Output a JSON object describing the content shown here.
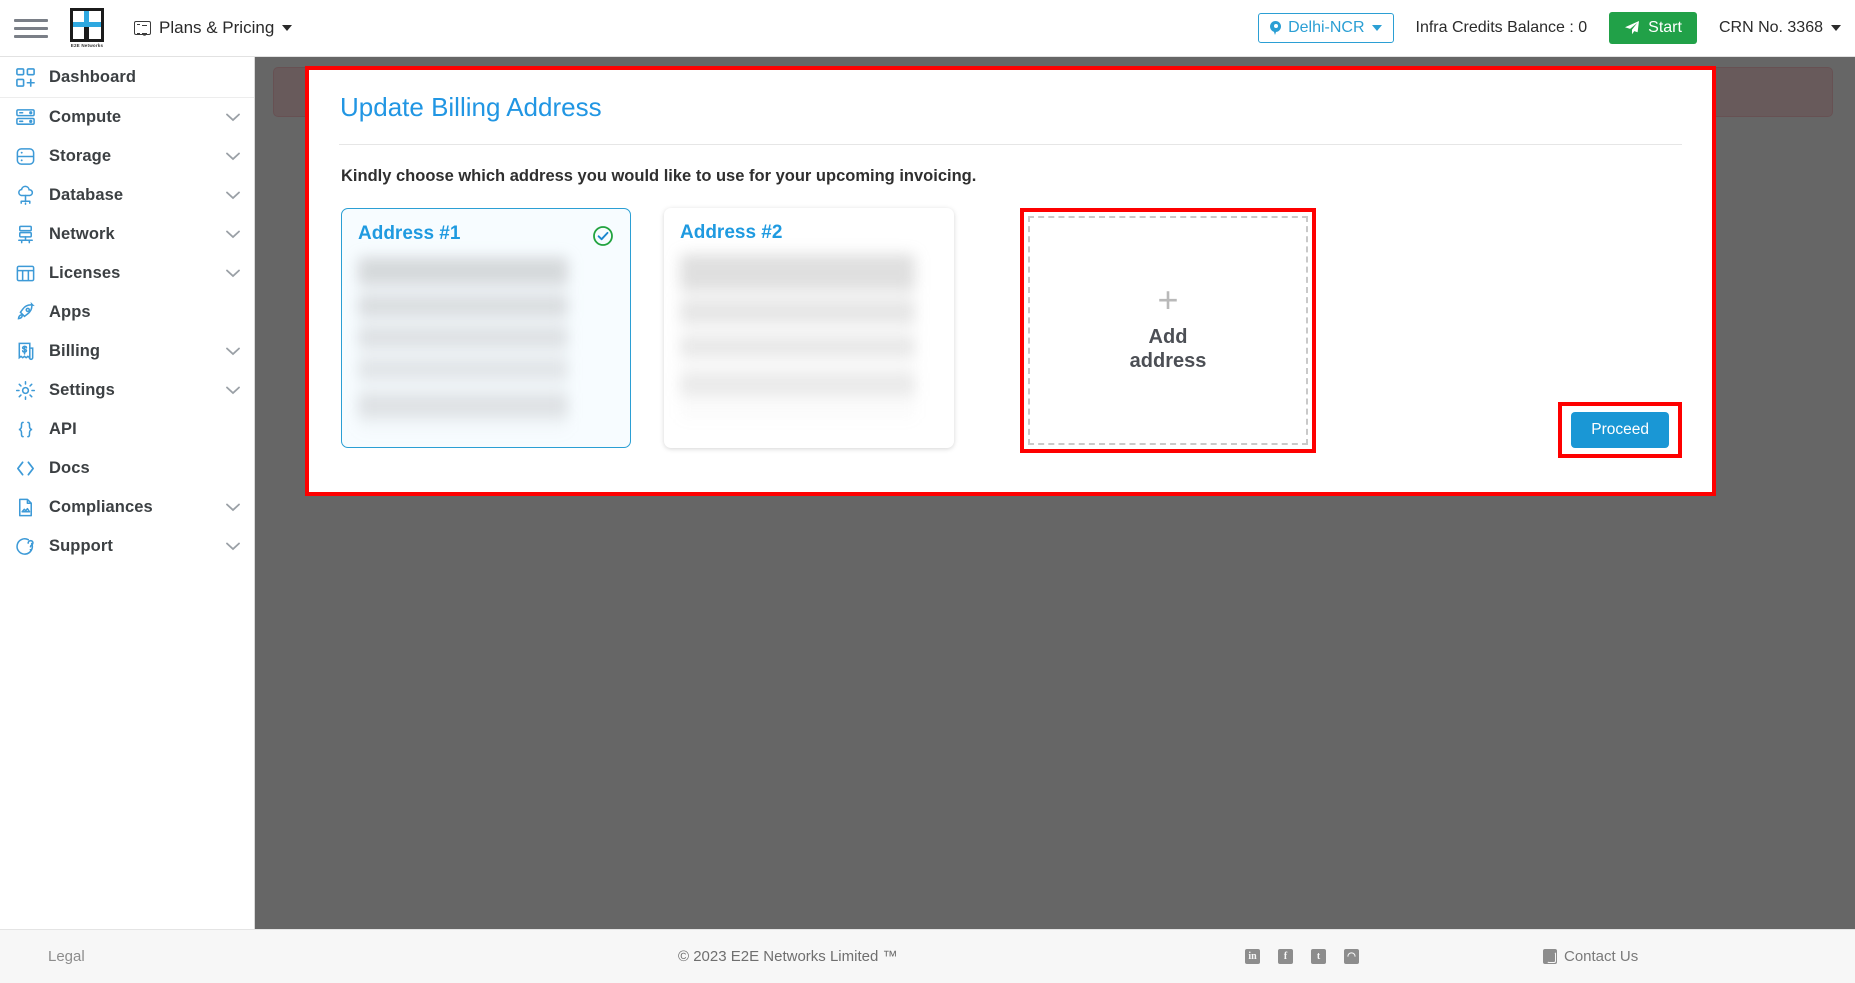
{
  "header": {
    "menu_icon": "hamburger-icon",
    "logo_caption": "E2E Networks",
    "plans_label": "Plans & Pricing",
    "region_label": "Delhi-NCR",
    "credits_label": "Infra Credits Balance : 0",
    "start_label": "Start",
    "crn_label": "CRN No. 3368"
  },
  "sidebar": {
    "items": [
      {
        "label": "Dashboard",
        "icon": "dashboard-icon",
        "expandable": false
      },
      {
        "label": "Compute",
        "icon": "server-icon",
        "expandable": true
      },
      {
        "label": "Storage",
        "icon": "database-disk-icon",
        "expandable": true
      },
      {
        "label": "Database",
        "icon": "cloud-database-icon",
        "expandable": true
      },
      {
        "label": "Network",
        "icon": "network-icon",
        "expandable": true
      },
      {
        "label": "Licenses",
        "icon": "grid-icon",
        "expandable": true
      },
      {
        "label": "Apps",
        "icon": "rocket-icon",
        "expandable": false
      },
      {
        "label": "Billing",
        "icon": "invoice-icon",
        "expandable": true
      },
      {
        "label": "Settings",
        "icon": "gear-icon",
        "expandable": true
      },
      {
        "label": "API",
        "icon": "braces-icon",
        "expandable": false
      },
      {
        "label": "Docs",
        "icon": "code-brackets-icon",
        "expandable": false
      },
      {
        "label": "Compliances",
        "icon": "document-icon",
        "expandable": true
      },
      {
        "label": "Support",
        "icon": "lifebuoy-icon",
        "expandable": true
      }
    ]
  },
  "modal": {
    "title": "Update Billing Address",
    "subtitle": "Kindly choose which address you would like to use for your upcoming invoicing.",
    "addresses": [
      {
        "title": "Address #1",
        "selected": true,
        "details_redacted": true
      },
      {
        "title": "Address #2",
        "selected": false,
        "details_redacted": true
      }
    ],
    "add_address": {
      "plus_glyph": "+",
      "label_line1": "Add",
      "label_line2": "address"
    },
    "proceed_label": "Proceed"
  },
  "footer": {
    "legal_label": "Legal",
    "copyright": "© 2023 E2E Networks Limited ™",
    "social": [
      {
        "name": "linkedin-icon",
        "glyph": "in"
      },
      {
        "name": "facebook-icon",
        "glyph": "f"
      },
      {
        "name": "twitter-icon",
        "glyph": "t"
      },
      {
        "name": "rss-icon",
        "glyph": "◠"
      }
    ],
    "contact_label": "Contact Us"
  },
  "colors": {
    "accent_blue": "#2196e3",
    "highlight_red": "#fe0000",
    "success_green": "#21a148",
    "overlay": "rgba(0,0,0,0.58)"
  }
}
